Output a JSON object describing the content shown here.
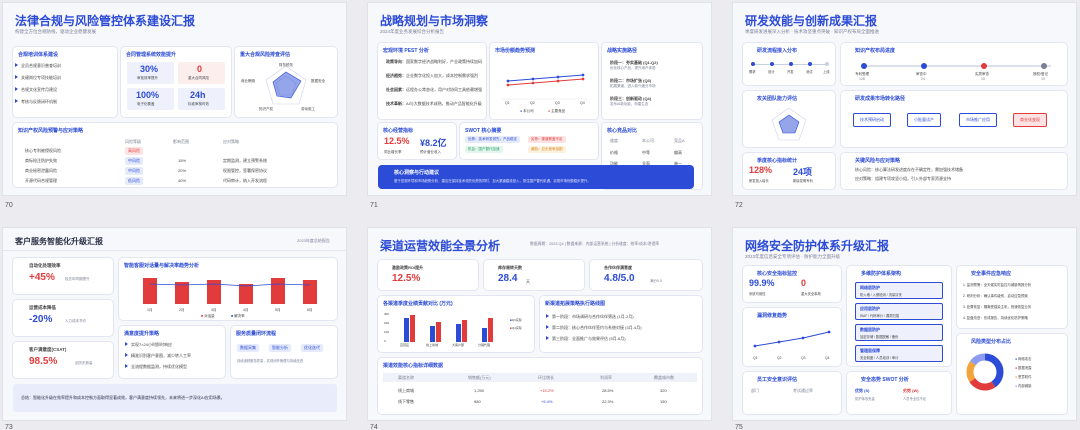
{
  "s70": {
    "num": "70",
    "title": "法律合规与风险管控体系建设汇报",
    "subtitle": "构建全方位合规防线，驱动企业稳健发展",
    "c1": {
      "title": "合规培训体系建设",
      "items": [
        "全员合规意识普查培训",
        "关键岗位专项技能培训",
        "合规文化宣传月建设",
        "考核与反馈闭环机制"
      ]
    },
    "c2": {
      "title": "合同管理系统效能提升",
      "stats": [
        {
          "v": "30%",
          "l": "审批效率提升"
        },
        {
          "v": "0",
          "l": "重大合同风险"
        },
        {
          "v": "100%",
          "l": "电子化覆盖"
        },
        {
          "v": "24h",
          "l": "标准审核时效"
        }
      ]
    },
    "c3": {
      "title": "重大合规风险排查评估",
      "labels": [
        "财务税务",
        "数据安全",
        "劳动用工",
        "知识产权",
        "商业贿赂"
      ]
    },
    "c4": {
      "title": "知识产权风险预警与应对策略",
      "headers": [
        "风险等级",
        "影响范围",
        "应对策略"
      ],
      "rows": [
        {
          "name": "核心专利被侵权风险",
          "level": "高风险",
          "pct": "",
          "act": ""
        },
        {
          "name": "商标抢注防护失效",
          "level": "中风险",
          "pct": "15%",
          "act": "定期监测，建立预警系统"
        },
        {
          "name": "商业秘密泄露风险",
          "level": "中风险",
          "pct": "20%",
          "act": "权限管控，签署保密协议"
        },
        {
          "name": "开源代码合规管理",
          "level": "低风险",
          "pct": "40%",
          "act": "代码审计，纳入开发流程"
        }
      ]
    }
  },
  "s71": {
    "num": "71",
    "title": "战略规划与市场洞察",
    "subtitle": "2024年度业务发展综合分析报告",
    "pest": {
      "title": "宏观环境 PEST 分析",
      "items": [
        {
          "k": "政策导向：",
          "v": "国家数字经济战略利好，产业政策持续加码"
        },
        {
          "k": "经济趋势：",
          "v": "企业数字化投入加大，成本控制需求强烈"
        },
        {
          "k": "社会因素：",
          "v": "远程办公常态化，用户对协同工具依赖增强"
        },
        {
          "k": "技术革新：",
          "v": "AI与大数据技术成熟，推动产品智能化升级"
        }
      ]
    },
    "line": {
      "title": "市场份额趋势预测",
      "legend": [
        "本公司",
        "主要竞品"
      ],
      "x": [
        "Q1",
        "Q2",
        "Q3",
        "Q4"
      ]
    },
    "strategy": {
      "title": "战略实施路径",
      "items": [
        {
          "k": "阶段一：夯实基础 (Q1-Q2)",
          "v": "优化核心产品，提升用户体验"
        },
        {
          "k": "阶段二：市场扩张 (Q3)",
          "v": "拓展渠道，进入新兴细分市场"
        },
        {
          "k": "阶段三：创新驱动 (Q4)",
          "v": "发布AI新功能，构建生态"
        }
      ]
    },
    "kpi": {
      "title": "核心经营指标",
      "v1": "12.5%",
      "l1": "同比增长率",
      "v2": "¥8.2亿",
      "l2": "预计营业收入"
    },
    "swot": {
      "title": "SWOT 核心摘要",
      "cells": [
        "优势：技术研发领先，产品稳定",
        "劣势：渠道覆盖不足",
        "机会：国产替代加速",
        "威胁：巨头竞争加剧"
      ]
    },
    "comp": {
      "title": "核心竞品对比",
      "headers": [
        "维度",
        "本公司",
        "竞品A"
      ],
      "rows": [
        [
          "价格",
          "中等",
          "偏高"
        ],
        [
          "功能",
          "全面",
          "单一"
        ],
        [
          "服务",
          "优质",
          "一般"
        ]
      ]
    },
    "banner": {
      "title": "核心洞察与行动建议",
      "text": "基于宏观环境和市场趋势分析，建议在保持技术领先优势的同时，加大渠道建设投入，抓住国产替代机遇，实现市场份额稳步提升。"
    }
  },
  "s72": {
    "num": "72",
    "title": "研发效能与创新成果汇报",
    "subtitle": "季度研发进展深入分析 · 技术攻坚重点突破 · 知识产权布局全面推进",
    "pipe": {
      "title": "研发流程接入分布",
      "labels": [
        "需求",
        "设计",
        "开发",
        "测试",
        "上线"
      ]
    },
    "patent": {
      "title": "知识产权布局进度",
      "stages": [
        "专利受理",
        "审查中",
        "实质审查",
        "授权/登记"
      ],
      "vals": [
        "128",
        "24",
        "15",
        "10"
      ]
    },
    "team": {
      "title": "攻关团队能力评估"
    },
    "path": {
      "title": "研发成果市场转化路径",
      "steps": [
        "技术预研启动",
        "小批量试产",
        "市场推广应用",
        "商业化变现"
      ]
    },
    "trend": {
      "title": "季度核心指标统计",
      "v1": "128%",
      "l1": "研发投入增长",
      "v2": "24项",
      "l2": "新增发明专利"
    },
    "risk": {
      "title": "关键风险与应对策略",
      "items": [
        "核心风险：核心算法研发进度存在不确定性，需加强技术储备",
        "应对策略：组建专项攻坚小组，引入外部专家资源支持"
      ]
    }
  },
  "s73": {
    "num": "73",
    "title": "客户服务智能化升级汇报",
    "date": "2023年度总结报告",
    "kpis": [
      {
        "label": "自动化处理效率",
        "value": "+45%",
        "note": "较去年同期提升"
      },
      {
        "label": "运营成本降低",
        "value": "-20%",
        "note": "人力成本节约"
      },
      {
        "label": "客户满意度(CSAT)",
        "value": "98.5%",
        "note": "创历史新高"
      }
    ],
    "chart": {
      "title": "智能客服对话量与解决率趋势分析",
      "x": [
        "1月",
        "2月",
        "3月",
        "4月",
        "5月",
        "6月"
      ],
      "legend": [
        "对话量",
        "解决率"
      ]
    },
    "strategy": {
      "title": "满意度提升策略",
      "items": [
        "实现7×24小时即时响应",
        "精准识别客户意图，减少转人工率",
        "全流程数据监测，持续优化模型"
      ]
    },
    "flow": {
      "title": "服务质量闭环流程",
      "steps": [
        "数据采集",
        "智能分析",
        "优化迭代"
      ],
      "note": "持续追踪服务质量，实现闭环管理与持续改进"
    },
    "summary": "总结：智能化升级在效率提升和成本控制方面取得显著成效，客户满意度持续领先，未来将进一步深化AI应用场景。"
  },
  "s74": {
    "num": "74",
    "title": "渠道运营效能全景分析",
    "meta": "数据周期：2023 Q4 | 数据来源：内部运营系统 | 分析维度：效率/成本/渗透率",
    "kpis": [
      {
        "label": "激励政策ROI提升",
        "value": "12.5%",
        "unit": ""
      },
      {
        "label": "库存周转天数",
        "value": "28.4",
        "unit": "天"
      },
      {
        "label": "合作伙伴满意度",
        "value": "4.8/5.0",
        "unit": "满分5.0"
      }
    ],
    "bars": {
      "title": "各渠道季度业绩贡献对比 (万元)",
      "cats": [
        "直营店",
        "线上商城",
        "大客户部",
        "分销代理"
      ],
      "legend": [
        "Q3实际",
        "Q4实际"
      ],
      "ticks": [
        "300",
        "200",
        "100",
        "0"
      ]
    },
    "plan": {
      "title": "新渠道拓展策略执行路线图",
      "items": [
        "第一阶段：市场调研与合作伙伴筛选 (1月-2月)",
        "第二阶段：核心合作伙伴签约与系统对接 (3月-4月)",
        "第三阶段：全面推广与效果评估 (5月-6月)"
      ]
    },
    "table": {
      "title": "渠道效能核心指标详细数据",
      "headers": [
        "渠道名称",
        "销售额(万元)",
        "环比增长",
        "利润率",
        "覆盖城市数"
      ],
      "rows": [
        [
          "线上商城",
          "1,250",
          "+15.2%",
          "28.5%",
          "320"
        ],
        [
          "线下零售",
          "980",
          "+5.4%",
          "22.3%",
          "150"
        ]
      ]
    }
  },
  "s75": {
    "num": "75",
    "title": "网络安全防护体系升级汇报",
    "subtitle": "2023年度信息安全专项评估 · 防护能力全面升级",
    "monitor": {
      "title": "核心安全指标监控",
      "v1": "99.9%",
      "l1": "系统可用性",
      "v2": "0",
      "l2": "重大安全事故"
    },
    "arch": {
      "title": "多维防护体系架构",
      "layers": [
        {
          "t": "网络层防护",
          "d": "防火墙 / 入侵检测 / 流量清洗"
        },
        {
          "t": "应用层防护",
          "d": "WAF / 代码审计 / 漏洞扫描"
        },
        {
          "t": "数据层防护",
          "d": "加密存储 / 数据脱敏 / 备份"
        },
        {
          "t": "管理层保障",
          "d": "安全制度 / 人员培训 / 审计"
        }
      ]
    },
    "incident": {
      "title": "安全事件应急响应",
      "items": [
        "1. 监测预警：全天候实时监控与威胁情报分析",
        "2. 研判分析：确认事件级别，启动应急预案",
        "3. 处置恢复：隔离受感染主机，快速恢复业务",
        "4. 复盘改进：形成报告，持续优化防护策略"
      ]
    },
    "trend": {
      "title": "漏洞修复趋势",
      "x": [
        "Q1",
        "Q2",
        "Q3",
        "Q4"
      ]
    },
    "pie": {
      "title": "风险类型分布占比",
      "legend": [
        "网络攻击",
        "数据泄露",
        "恶意软件",
        "内部威胁"
      ]
    },
    "eval": {
      "title": "员工安全意识评估",
      "headers": [
        "部门",
        "考试通过率"
      ]
    },
    "swot": {
      "title": "安全态势 SWOT 分析",
      "cells": [
        "优势 (S)",
        "劣势 (W)"
      ],
      "notes": [
        "防护体系完善",
        "人员专业性不足"
      ]
    }
  }
}
